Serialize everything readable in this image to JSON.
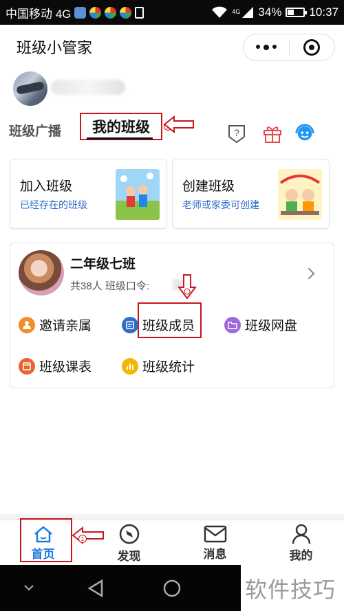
{
  "status_bar": {
    "carrier": "中国移动 4G",
    "signal_label": "4G",
    "battery": "34%",
    "battery_level": 0.34,
    "time": "10:37"
  },
  "nav": {
    "title": "班级小管家",
    "more_icon": "more-dots-icon",
    "close_icon": "target-icon"
  },
  "tabs": {
    "broadcast": "班级广播",
    "my_class": "我的班级",
    "help_icon": "question-shield-icon",
    "gift_icon": "gift-icon",
    "service_icon": "customer-service-icon"
  },
  "cards": {
    "join": {
      "title": "加入班级",
      "subtitle": "已经存在的班级"
    },
    "create": {
      "title": "创建班级",
      "subtitle": "老师或家委可创建"
    }
  },
  "class": {
    "name": "二年级七班",
    "meta": "共38人 班级口令:",
    "actions": {
      "invite": "邀请亲属",
      "members": "班级成员",
      "drive": "班级网盘",
      "schedule": "班级课表",
      "stats": "班级统计"
    }
  },
  "tabbar": {
    "home": "首页",
    "discover": "发现",
    "messages": "消息",
    "mine": "我的"
  },
  "watermark": "软件技巧",
  "colors": {
    "annotation_red": "#c8161d",
    "link_blue": "#2f6ec8",
    "active_blue": "#1e7be0",
    "gift_red": "#e5484d",
    "service_blue": "#2196f3"
  }
}
